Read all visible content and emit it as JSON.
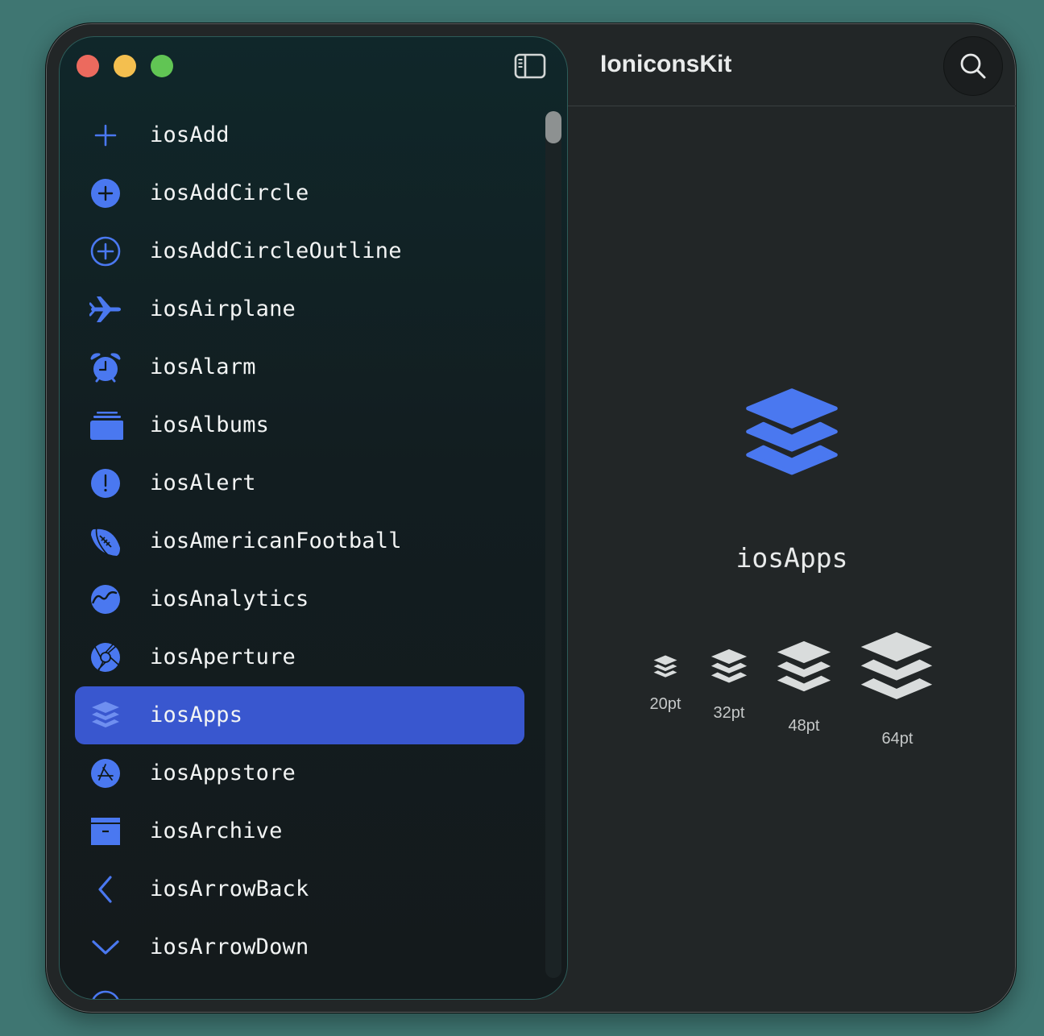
{
  "window": {
    "title": "IoniconsKit",
    "controls": [
      "close",
      "minimize",
      "zoom"
    ],
    "toolbar": {
      "sidebar_toggle_icon": "sidebar-toggle-icon",
      "search_icon": "magnifying-glass-icon"
    }
  },
  "sidebar": {
    "items": [
      {
        "label": "iosAdd",
        "icon": "plus-icon"
      },
      {
        "label": "iosAddCircle",
        "icon": "add-circle-icon"
      },
      {
        "label": "iosAddCircleOutline",
        "icon": "add-circle-outline-icon"
      },
      {
        "label": "iosAirplane",
        "icon": "airplane-icon"
      },
      {
        "label": "iosAlarm",
        "icon": "alarm-clock-icon"
      },
      {
        "label": "iosAlbums",
        "icon": "albums-icon"
      },
      {
        "label": "iosAlert",
        "icon": "alert-icon"
      },
      {
        "label": "iosAmericanFootball",
        "icon": "american-football-icon"
      },
      {
        "label": "iosAnalytics",
        "icon": "analytics-icon"
      },
      {
        "label": "iosAperture",
        "icon": "aperture-icon"
      },
      {
        "label": "iosApps",
        "icon": "layers-icon",
        "selected": true
      },
      {
        "label": "iosAppstore",
        "icon": "appstore-icon"
      },
      {
        "label": "iosArchive",
        "icon": "archive-icon"
      },
      {
        "label": "iosArrowBack",
        "icon": "chevron-left-icon"
      },
      {
        "label": "iosArrowDown",
        "icon": "chevron-down-icon"
      }
    ]
  },
  "detail": {
    "name": "iosApps",
    "icon": "layers-icon",
    "sizes": [
      {
        "label": "20pt"
      },
      {
        "label": "32pt"
      },
      {
        "label": "48pt"
      },
      {
        "label": "64pt"
      }
    ]
  },
  "colors": {
    "accent": "#4a78f0",
    "selection": "#3957cf",
    "preview_icon": "#d9dcdc"
  }
}
